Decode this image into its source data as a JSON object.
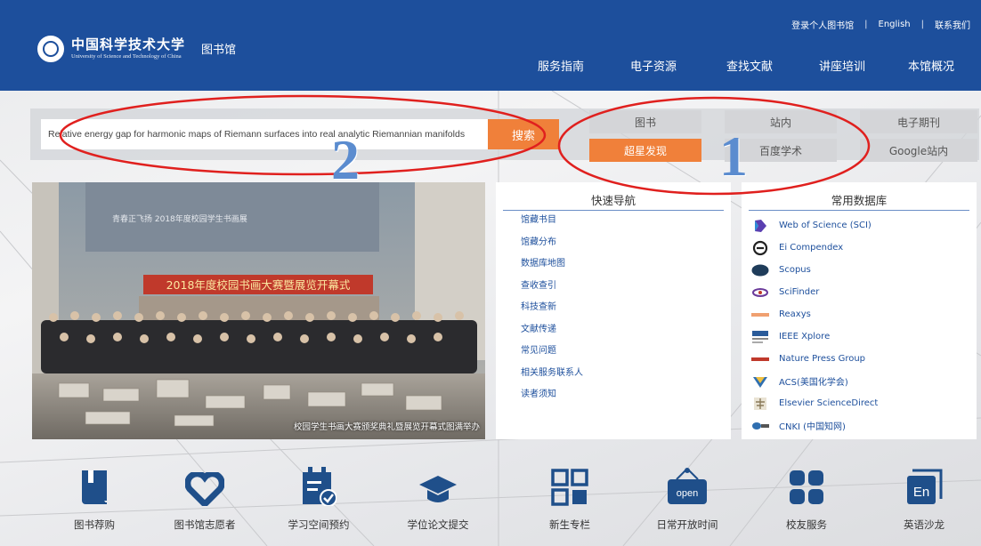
{
  "header": {
    "logo_cn": "中国科学技术大学",
    "logo_en": "University of Science and Technology of China",
    "library_name": "图书馆",
    "top_links": [
      "登录个人图书馆",
      "English",
      "联系我们"
    ],
    "nav": [
      "服务指南",
      "电子资源",
      "查找文献",
      "讲座培训",
      "本馆概况"
    ]
  },
  "search": {
    "query": "Relative energy gap for harmonic maps of Riemann surfaces into real analytic Riemannian manifolds",
    "button_label": "搜索",
    "categories": [
      {
        "label": "图书",
        "active": false
      },
      {
        "label": "站内",
        "active": false
      },
      {
        "label": "电子期刊",
        "active": false
      },
      {
        "label": "超星发现",
        "active": true
      },
      {
        "label": "百度学术",
        "active": false
      },
      {
        "label": "Google站内",
        "active": false
      }
    ]
  },
  "banner": {
    "caption": "校园学生书画大赛颁奖典礼暨展览开幕式图满举办",
    "banner_text": "2018年度校园书画大赛暨展览开幕式",
    "backdrop_text": "青春正飞扬 2018年度校园学生书画展"
  },
  "quick_nav": {
    "title": "快速导航",
    "items": [
      "馆藏书目",
      "馆藏分布",
      "数据库地图",
      "查收查引",
      "科技查新",
      "文献传递",
      "常见问题",
      "相关服务联系人",
      "读者须知"
    ]
  },
  "databases": {
    "title": "常用数据库",
    "items": [
      {
        "label": "Web of Science (SCI)",
        "icon": "web-of-science-icon"
      },
      {
        "label": "Ei Compendex",
        "icon": "ei-compendex-icon"
      },
      {
        "label": "Scopus",
        "icon": "scopus-icon"
      },
      {
        "label": "SciFinder",
        "icon": "scifinder-icon"
      },
      {
        "label": "Reaxys",
        "icon": "reaxys-icon"
      },
      {
        "label": "IEEE Xplore",
        "icon": "ieee-icon"
      },
      {
        "label": "Nature Press Group",
        "icon": "nature-icon"
      },
      {
        "label": "ACS(美国化学会)",
        "icon": "acs-icon"
      },
      {
        "label": "Elsevier ScienceDirect",
        "icon": "elsevier-icon"
      },
      {
        "label": "CNKI (中国知网)",
        "icon": "cnki-icon"
      }
    ]
  },
  "quick_icons": [
    {
      "label": "图书荐购",
      "icon": "book-icon"
    },
    {
      "label": "图书馆志愿者",
      "icon": "heart-icon"
    },
    {
      "label": "学习空间预约",
      "icon": "calendar-check-icon"
    },
    {
      "label": "学位论文提交",
      "icon": "graduation-cap-icon"
    },
    {
      "label": "新生专栏",
      "icon": "grid-icon"
    },
    {
      "label": "日常开放时间",
      "icon": "open-sign-icon",
      "badge": "open"
    },
    {
      "label": "校友服务",
      "icon": "tiles-icon"
    },
    {
      "label": "英语沙龙",
      "icon": "english-icon",
      "badge": "En"
    }
  ],
  "annotations": [
    "1",
    "2"
  ],
  "colors": {
    "header_blue": "#1d4f9c",
    "accent_orange": "#f0803a",
    "annotation_red": "#e0201e",
    "annotation_blue": "#5b8ccf"
  }
}
